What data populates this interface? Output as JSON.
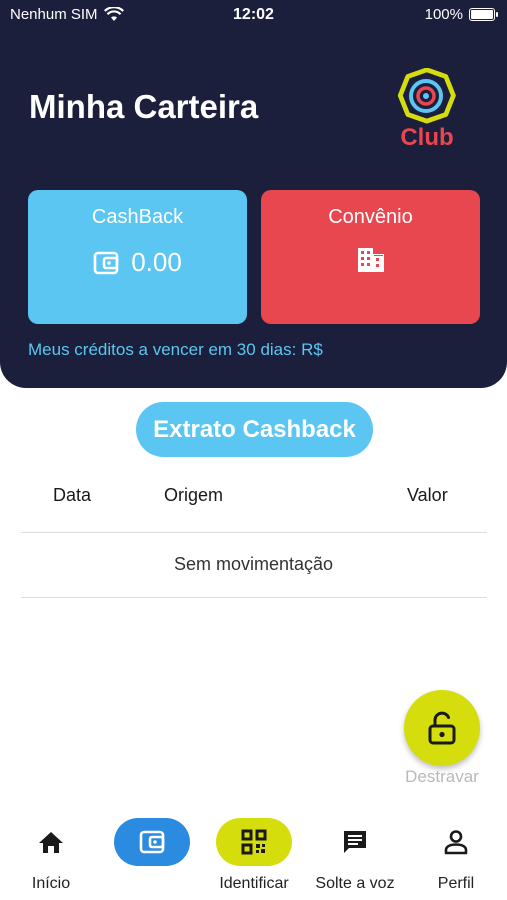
{
  "status_bar": {
    "carrier": "Nenhum SIM",
    "time": "12:02",
    "battery": "100%"
  },
  "header": {
    "title": "Minha Carteira",
    "logo_text": "Club"
  },
  "cards": {
    "cashback": {
      "title": "CashBack",
      "value": "0.00"
    },
    "convenio": {
      "title": "Convênio"
    }
  },
  "credits_text": "Meus créditos a vencer em 30 dias: R$",
  "extrato_button": "Extrato Cashback",
  "table": {
    "columns": [
      "Data",
      "Origem",
      "Valor"
    ],
    "empty_text": "Sem movimentação"
  },
  "fab": {
    "label": "Destravar"
  },
  "nav": {
    "items": [
      {
        "label": "Início"
      },
      {
        "label": ""
      },
      {
        "label": "Identificar"
      },
      {
        "label": "Solte a voz"
      },
      {
        "label": "Perfil"
      }
    ]
  },
  "colors": {
    "header_bg": "#1b1f3b",
    "cashback": "#5bc6f2",
    "convenio": "#e8474f",
    "accent_yellow": "#d6dd0c",
    "wallet_blue": "#2a8be0"
  }
}
